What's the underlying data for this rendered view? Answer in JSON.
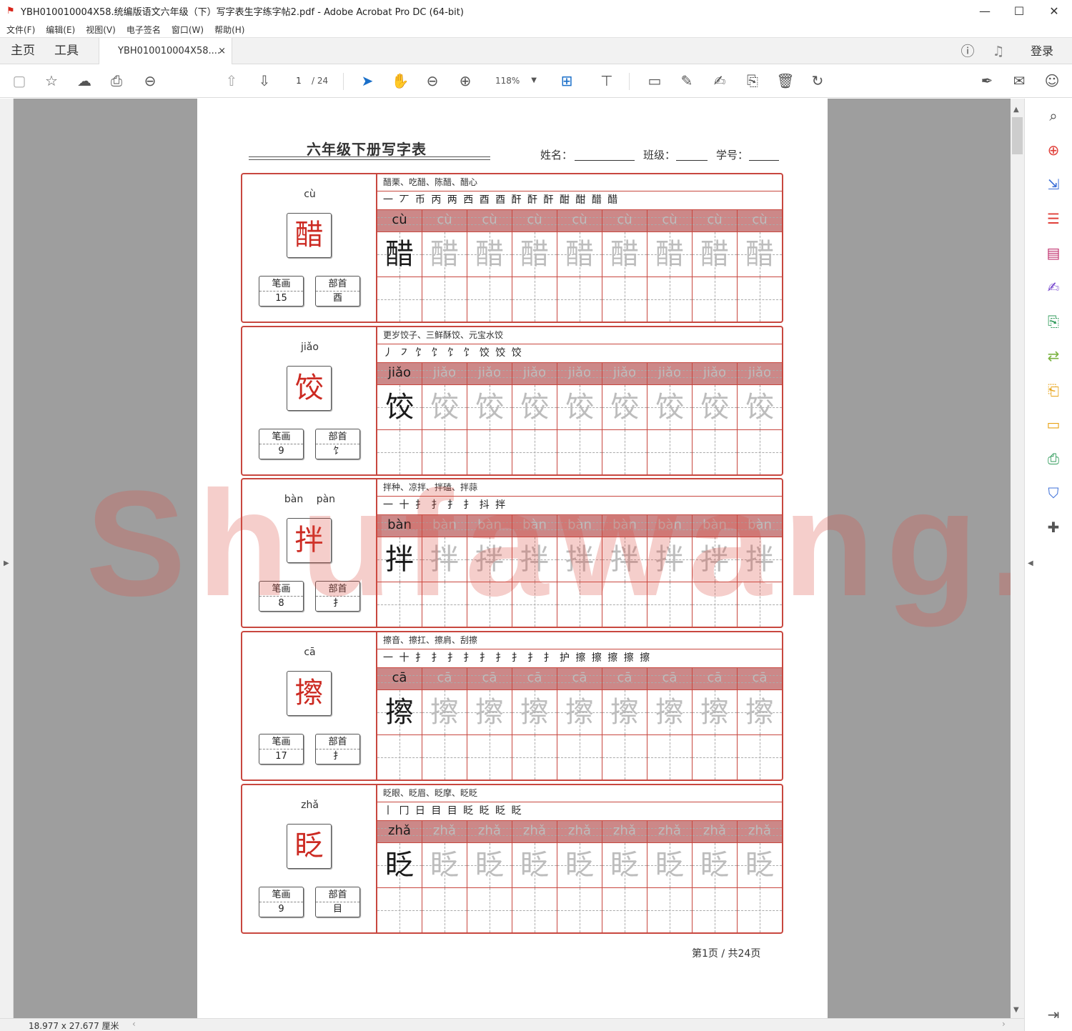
{
  "window": {
    "title": "YBH010010004X58.统编版语文六年级（下）写字表生字练字帖2.pdf - Adobe Acrobat Pro DC (64-bit)",
    "minimize": "—",
    "maximize": "☐",
    "close": "✕"
  },
  "menu": [
    "文件(F)",
    "编辑(E)",
    "视图(V)",
    "电子签名",
    "窗口(W)",
    "帮助(H)"
  ],
  "tabs": {
    "home": "主页",
    "tools": "工具",
    "document": "YBH010010004X58....",
    "document_close": "×",
    "login": "登录"
  },
  "toolbar": {
    "page_current": "1",
    "page_total": "/ 24",
    "zoom": "118%",
    "icons": [
      "save-icon",
      "bookmark-star-icon",
      "upload-cloud-icon",
      "print-icon",
      "zoom-out-search-icon",
      "page-up-icon",
      "page-down-icon",
      "zoom-minus-icon",
      "zoom-plus-icon",
      "select-arrow-icon",
      "hand-icon",
      "page-fit-icon",
      "scroll-mode-icon",
      "comment-icon",
      "highlight-pen-icon",
      "draw-pen-icon",
      "stamp-icon",
      "delete-icon",
      "rotate-icon",
      "sign-icon",
      "email-icon",
      "add-user-icon"
    ]
  },
  "status": {
    "dimensions": "18.977 x 27.677 厘米"
  },
  "watermark": "Shufawang.CN",
  "page": {
    "title": "六年级下册写字表",
    "name_label": "姓名：",
    "class_label": "班级：",
    "number_label": "学号：",
    "footer": "第1页 / 共24页",
    "stroke_label": "笔画",
    "radical_label": "部首",
    "entries": [
      {
        "char": "醋",
        "pinyin": "cù",
        "pinyin_top": "cù",
        "strokes": "15",
        "radical": "酉",
        "words": "醋栗、吃醋、陈醋、醋心",
        "stroke_order": "一 丆 币 丙 两 西 酉 酉 酐 酐 酐 酣 酣 醋 醋"
      },
      {
        "char": "饺",
        "pinyin": "jiǎo",
        "pinyin_top": "jiǎo",
        "strokes": "9",
        "radical": "饣",
        "words": "更岁饺子、三鲜酥饺、元宝水饺",
        "stroke_order": "丿 ㇇ 饣 饣 饣 饣 饺 饺 饺"
      },
      {
        "char": "拌",
        "pinyin": "bàn",
        "pinyin_top": "bàn pàn",
        "strokes": "8",
        "radical": "扌",
        "words": "拌种、凉拌、拌磕、拌蒜",
        "stroke_order": "一 十 扌 扌 扌 扌 抖 拌"
      },
      {
        "char": "擦",
        "pinyin": "cā",
        "pinyin_top": "cā",
        "strokes": "17",
        "radical": "扌",
        "words": "擦音、擦扛、擦肩、刮擦",
        "stroke_order": "一 十 扌 扌 扌 扌 扌 扌 扌 扌 扌 护 擦 擦 擦 擦 擦"
      },
      {
        "char": "眨",
        "pinyin": "zhǎ",
        "pinyin_top": "zhǎ",
        "strokes": "9",
        "radical": "目",
        "words": "眨眼、眨眉、眨摩、眨眨",
        "stroke_order": "丨 冂 日 目 目 眨 眨 眨 眨"
      }
    ]
  }
}
